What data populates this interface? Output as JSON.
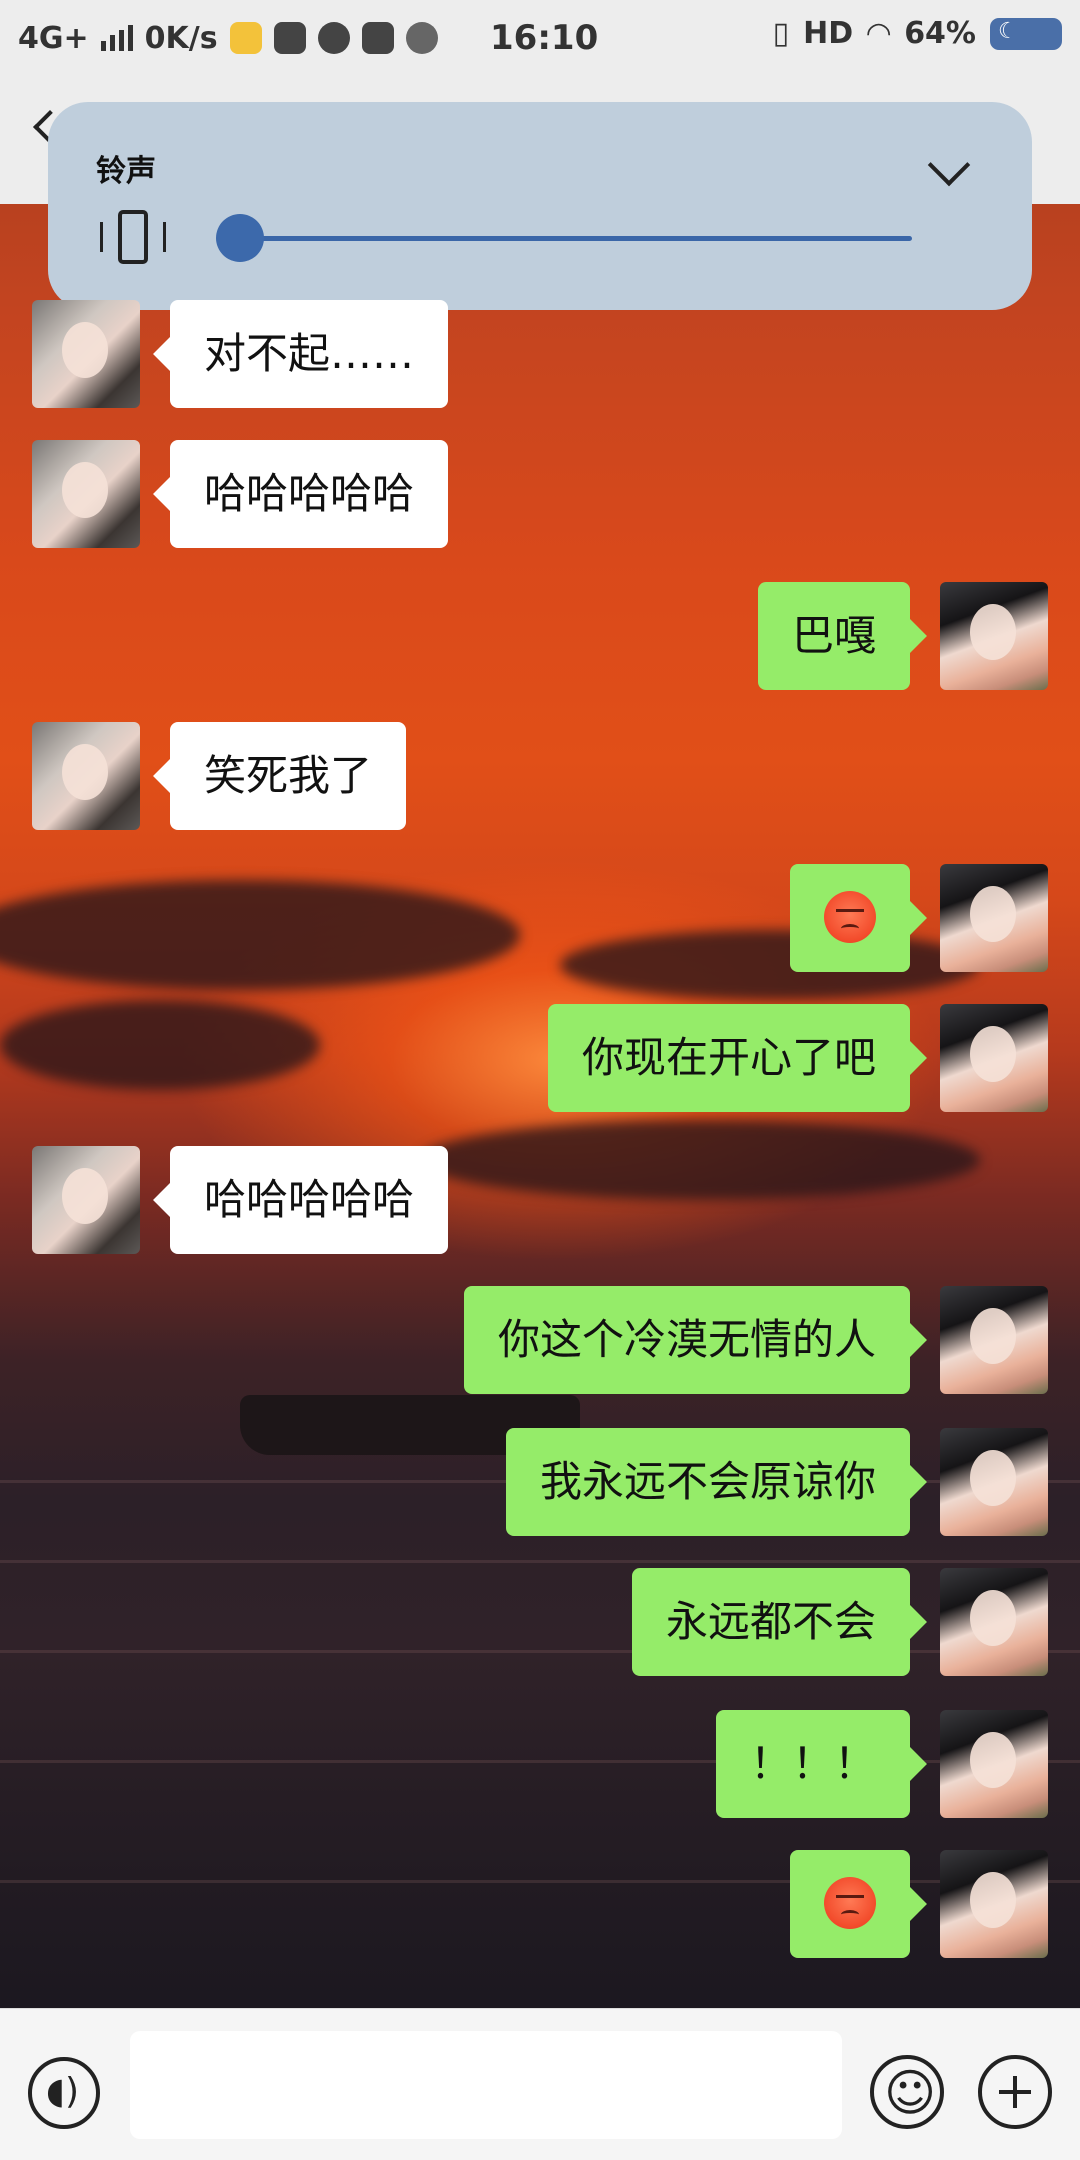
{
  "status_bar": {
    "network": "4G+",
    "speed": "0K/s",
    "time": "16:10",
    "hd": "HD",
    "battery": "64%"
  },
  "volume_panel": {
    "title": "铃声",
    "level": 0.0,
    "mode_icon": "vibrate-icon"
  },
  "messages": [
    {
      "side": "left",
      "text": "对不起……"
    },
    {
      "side": "left",
      "text": "哈哈哈哈哈"
    },
    {
      "side": "right",
      "text": "巴嘎"
    },
    {
      "side": "left",
      "text": "笑死我了"
    },
    {
      "side": "right",
      "text": "",
      "emoji": "angry-face"
    },
    {
      "side": "right",
      "text": "你现在开心了吧"
    },
    {
      "side": "left",
      "text": "哈哈哈哈哈"
    },
    {
      "side": "right",
      "text": "你这个冷漠无情的人"
    },
    {
      "side": "right",
      "text": "我永远不会原谅你"
    },
    {
      "side": "right",
      "text": "永远都不会"
    },
    {
      "side": "right",
      "text": "！！！"
    },
    {
      "side": "right",
      "text": "",
      "emoji": "angry-face"
    }
  ],
  "input": {
    "value": "",
    "placeholder": ""
  },
  "colors": {
    "sent_bubble": "#95ec69",
    "received_bubble": "#ffffff",
    "volume_panel": "#bfcedc",
    "slider": "#3c69ab"
  }
}
